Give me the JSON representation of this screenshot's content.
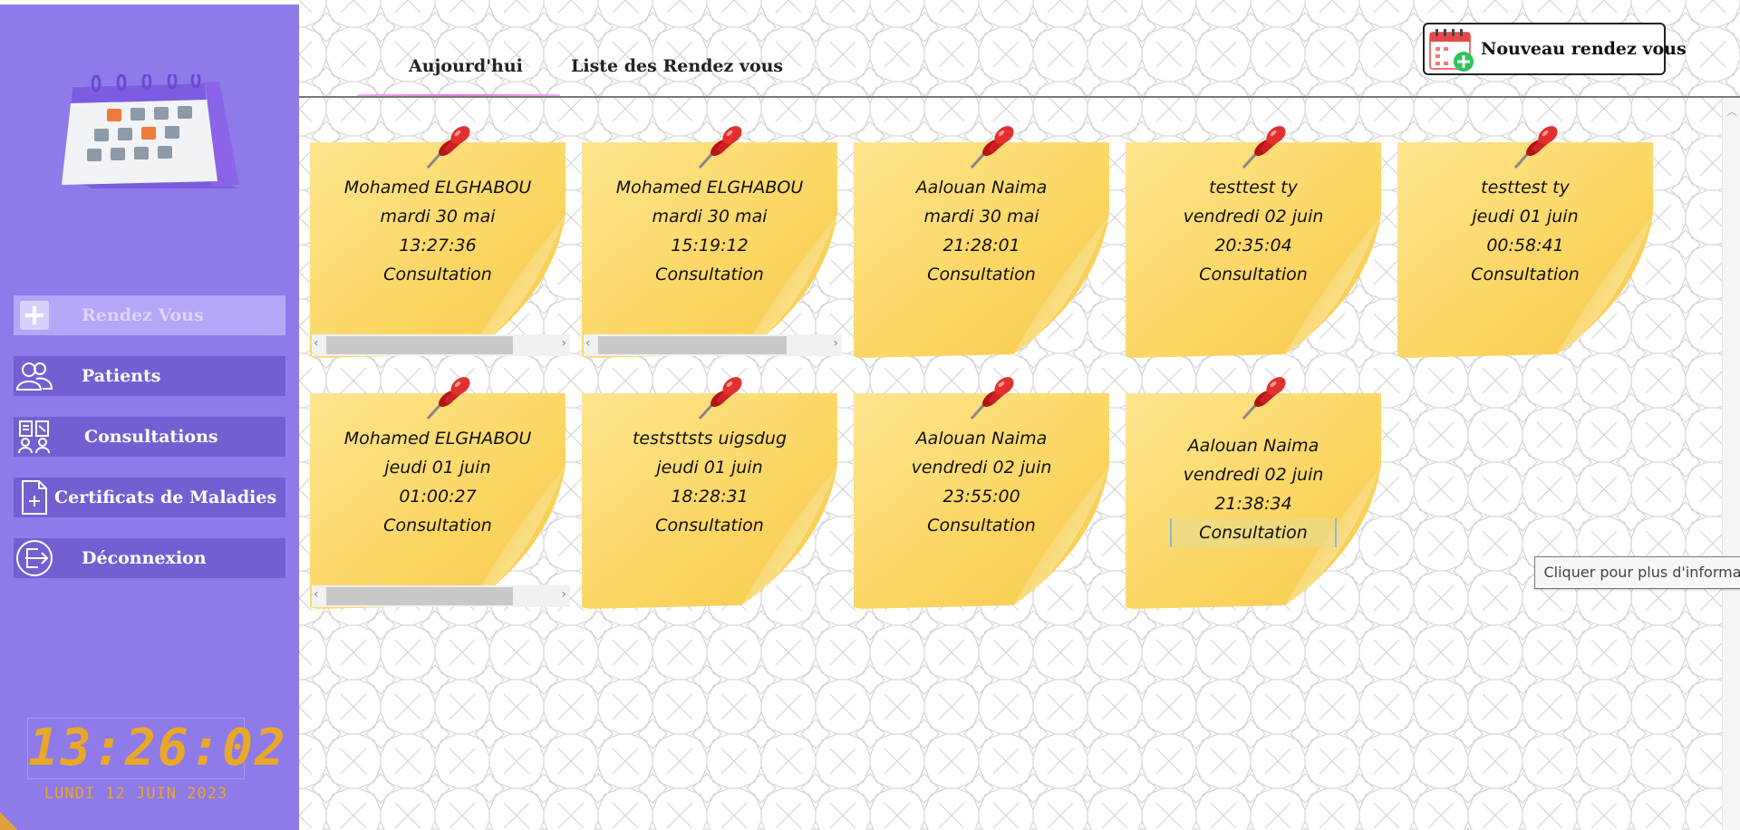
{
  "sidebar": {
    "logo_icon": "calendar-icon",
    "items": [
      {
        "label": "Rendez Vous",
        "icon": "plus-icon",
        "active": true
      },
      {
        "label": "Patients",
        "icon": "people-icon",
        "active": false
      },
      {
        "label": "Consultations",
        "icon": "doctors-icon",
        "active": false
      },
      {
        "label": "Certificats de Maladies",
        "icon": "document-plus-icon",
        "active": false
      },
      {
        "label": "Déconnexion",
        "icon": "logout-icon",
        "active": false
      }
    ],
    "clock": {
      "time": "13:26:02",
      "date": "LUNDI 12 JUIN 2023"
    }
  },
  "tabs": [
    {
      "label": "Aujourd'hui",
      "active": true
    },
    {
      "label": "Liste des Rendez vous",
      "active": false
    }
  ],
  "new_button": {
    "label": "Nouveau rendez vous",
    "icon": "calendar-add-icon"
  },
  "appointments": [
    {
      "name": "Mohamed ELGHABOU",
      "date": "mardi 30 mai",
      "time": "13:27:36",
      "type": "Consultation"
    },
    {
      "name": "Mohamed ELGHABOU",
      "date": "mardi 30 mai",
      "time": "15:19:12",
      "type": "Consultation"
    },
    {
      "name": "Aalouan Naima",
      "date": "mardi 30 mai",
      "time": "21:28:01",
      "type": "Consultation"
    },
    {
      "name": "testtest ty",
      "date": "vendredi 02 juin",
      "time": "20:35:04",
      "type": "Consultation"
    },
    {
      "name": "testtest ty",
      "date": "jeudi 01 juin",
      "time": "00:58:41",
      "type": "Consultation"
    },
    {
      "name": "Mohamed ELGHABOU",
      "date": "jeudi 01 juin",
      "time": "01:00:27",
      "type": "Consultation"
    },
    {
      "name": "teststtsts uigsdug",
      "date": "jeudi 01 juin",
      "time": "18:28:31",
      "type": "Consultation"
    },
    {
      "name": "Aalouan Naima",
      "date": "vendredi 02 juin",
      "time": "23:55:00",
      "type": "Consultation"
    },
    {
      "name": "Aalouan Naima",
      "date": "vendredi 02 juin",
      "time": "21:38:34",
      "type": "Consultation"
    }
  ],
  "tooltip": "Cliquer pour plus d'informations",
  "colors": {
    "sidebar": "#8e7ae9",
    "nav_item": "#735fd2",
    "nav_active": "#b5a6f7",
    "note": "#fbd764",
    "clock": "#e9a926",
    "tab_underline": "#e07ae0"
  }
}
